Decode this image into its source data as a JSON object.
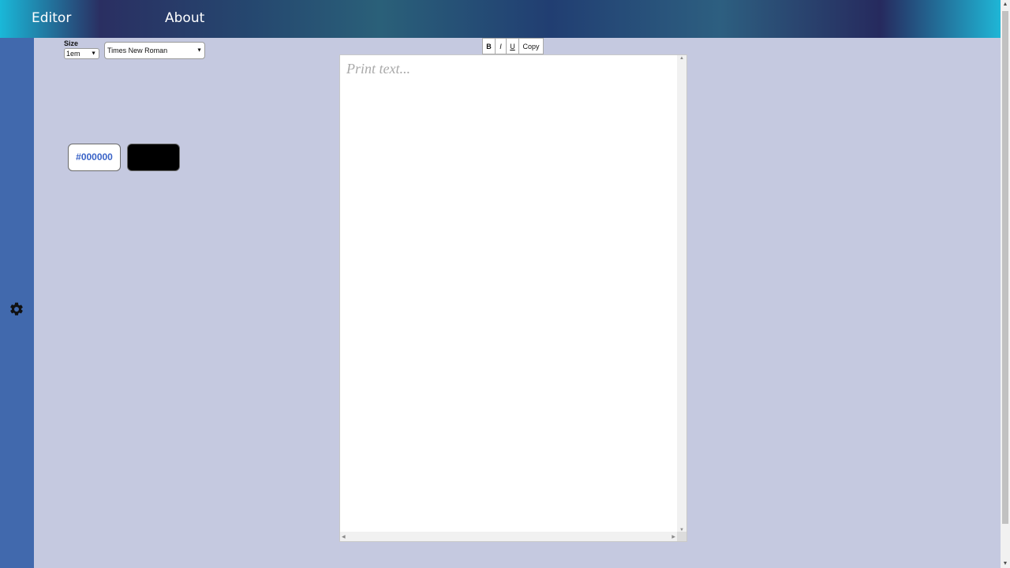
{
  "nav": {
    "editor_label": "Editor",
    "about_label": "About"
  },
  "sidebar": {
    "settings_icon": "gear-icon"
  },
  "controls": {
    "size_label": "Size",
    "size_value": "1em",
    "font_value": "Times New Roman",
    "hex_value": "#000000",
    "swatch_color": "#000000"
  },
  "toolbar": {
    "bold_label": "B",
    "italic_label": "I",
    "underline_label": "U",
    "copy_label": "Copy"
  },
  "editor": {
    "placeholder": "Print text..."
  },
  "colors": {
    "sidebar": "#4169ad",
    "background": "#c5c9e0",
    "hex_text": "#3a63c7"
  }
}
